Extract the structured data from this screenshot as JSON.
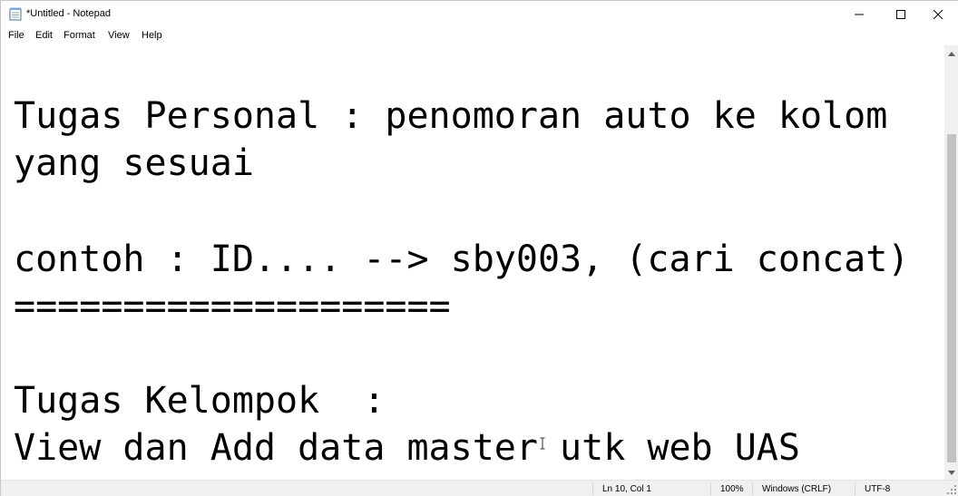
{
  "window": {
    "title": "*Untitled - Notepad",
    "icons": {
      "app": "notepad-icon",
      "minimize": "minimize-icon",
      "maximize": "maximize-icon",
      "close": "close-icon"
    }
  },
  "menu": [
    "File",
    "Edit",
    "Format",
    "View",
    "Help"
  ],
  "editor": {
    "lines": [
      "Tugas Personal : penomoran auto ke kolom",
      "yang sesuai",
      "",
      "contoh : ID.... --> sby003, (cari concat)",
      "====================",
      "",
      "Tugas Kelompok  :",
      "View dan Add data master utk web UAS"
    ]
  },
  "status": {
    "position": "Ln 10, Col 1",
    "zoom": "100%",
    "line_ending": "Windows (CRLF)",
    "encoding": "UTF-8"
  }
}
